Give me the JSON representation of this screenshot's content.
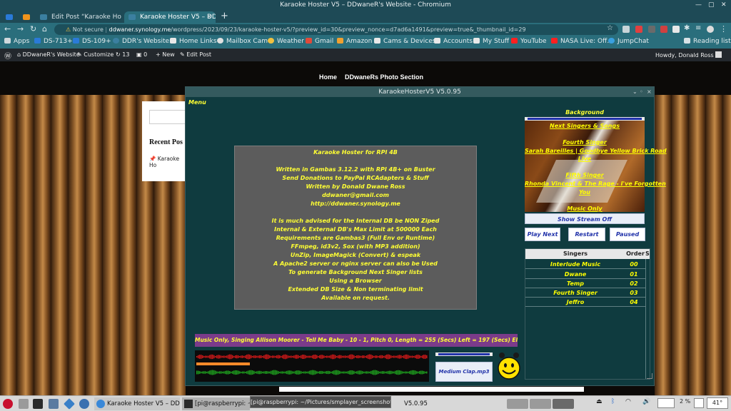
{
  "window": {
    "title": "Karaoke Hoster V5 – DDwaneR's Website - Chromium"
  },
  "tabs": [
    {
      "label": ""
    },
    {
      "label": ""
    },
    {
      "label": "Edit Post “Karaoke Hoster"
    },
    {
      "label": "Karaoke Hoster V5 – DD"
    }
  ],
  "toolbar": {
    "secure_label": "Not secure",
    "url_host": "ddwaner.synology.me",
    "url_path": "/wordpress/2023/09/23/karaoke-hoster-v5/?preview_id=30&preview_nonce=d7ad6a1491&preview=true&_thumbnail_id=29"
  },
  "bookmarks": {
    "items": [
      "Apps",
      "DS-713+",
      "DS-109+",
      "DDR's Website...",
      "Home Links",
      "Mailbox Cam",
      "Weather",
      "Gmail",
      "Amazon",
      "Cams & Devices",
      "Accounts",
      "My Stuff",
      "YouTube",
      "NASA Live: Off...",
      "JumpChat"
    ],
    "reading_list": "Reading list"
  },
  "wpadmin": {
    "site": "DDwaneR's Website",
    "customize": "Customize",
    "updates": "13",
    "comments": "0",
    "new": "New",
    "edit_post": "Edit Post",
    "howdy": "Howdy, Donald Ross"
  },
  "site": {
    "nav_home": "Home",
    "nav_photos": "DDwaneRs Photo Section",
    "recent_posts": "Recent Pos",
    "recent_item": "Karaoke Ho"
  },
  "app": {
    "title": "KaraokeHosterV5 V5.0.95",
    "menu": "Menu",
    "about_lines": [
      "Karaoke Hoster for RPI 4B",
      "",
      "Written in Gambas 3.12.2 with RPI 4B+ on Buster",
      "Send Donations to PayPal RCAdapters & Stuff",
      "Written by Donald Dwane Ross",
      "ddwaner@gmail.com",
      "http://ddwaner.synology.me",
      "",
      "It is much advised for the Internal DB be NON Ziped",
      "Internal & External DB's Max Limit at 500000 Each",
      "Requirements are Gambas3 (Full Env or Runtime)",
      "FFmpeg, id3v2, Sox (with MP3 addition)",
      "UnZip, ImageMagick (Convert) & espeak",
      "A Apache2 server or nginx server can also be Used",
      "To generate Background Next Singer lists",
      "Using a Browser",
      "Extended DB Size & Non terminating limit",
      "Available on request."
    ],
    "background_label": "Background",
    "next_singers": "Next Singers & Songs",
    "fourth_singer": "Fourth Singer",
    "song1_line1": "Sarah Bareilles | Goodbye Yellow Brick Road",
    "song1_line2": "Live",
    "fifth_singer": "Fifth Singer",
    "song2_line1": "Rhonda Vincent & The Rage - I've Forgotten",
    "song2_line2": "You",
    "music_only": "Music Only",
    "show_stream": "Show Stream Off",
    "play_next": "Play Next",
    "restart": "Restart",
    "paused": "Paused",
    "singers_header": "Singers",
    "order_header": "Order",
    "extra_header": "S",
    "singers": [
      {
        "name": "Interlude Music",
        "order": "00"
      },
      {
        "name": "Dwane",
        "order": "01"
      },
      {
        "name": "Temp",
        "order": "02"
      },
      {
        "name": "Fourth Singer",
        "order": "03"
      },
      {
        "name": "Jeffro",
        "order": "04"
      }
    ],
    "now_playing": "Music Only, Singing Allison Moorer - Tell Me Baby - 10 - 1, Pitch 0, Length = 255 (Secs) Left = 197 (Secs) Elapsed = 58 (Secs)",
    "progress_fraction": 0.23,
    "media_clip": "Medium Clap.mp3"
  },
  "taskbar": {
    "task1": "Karaoke Hoster V5 – DD...",
    "task2": "[pi@raspberrypi: ~/P",
    "task3": "V5.0.95",
    "tooltip": "[pi@raspberrypi: ~/Pictures/smplayer_screenshots]",
    "battery": "2 %",
    "temp": "41°"
  },
  "colors": {
    "accent": "#2a6e7c",
    "app_bg": "#0f3b3f",
    "yellow": "#ffff33",
    "purple": "#7b3b8a"
  }
}
